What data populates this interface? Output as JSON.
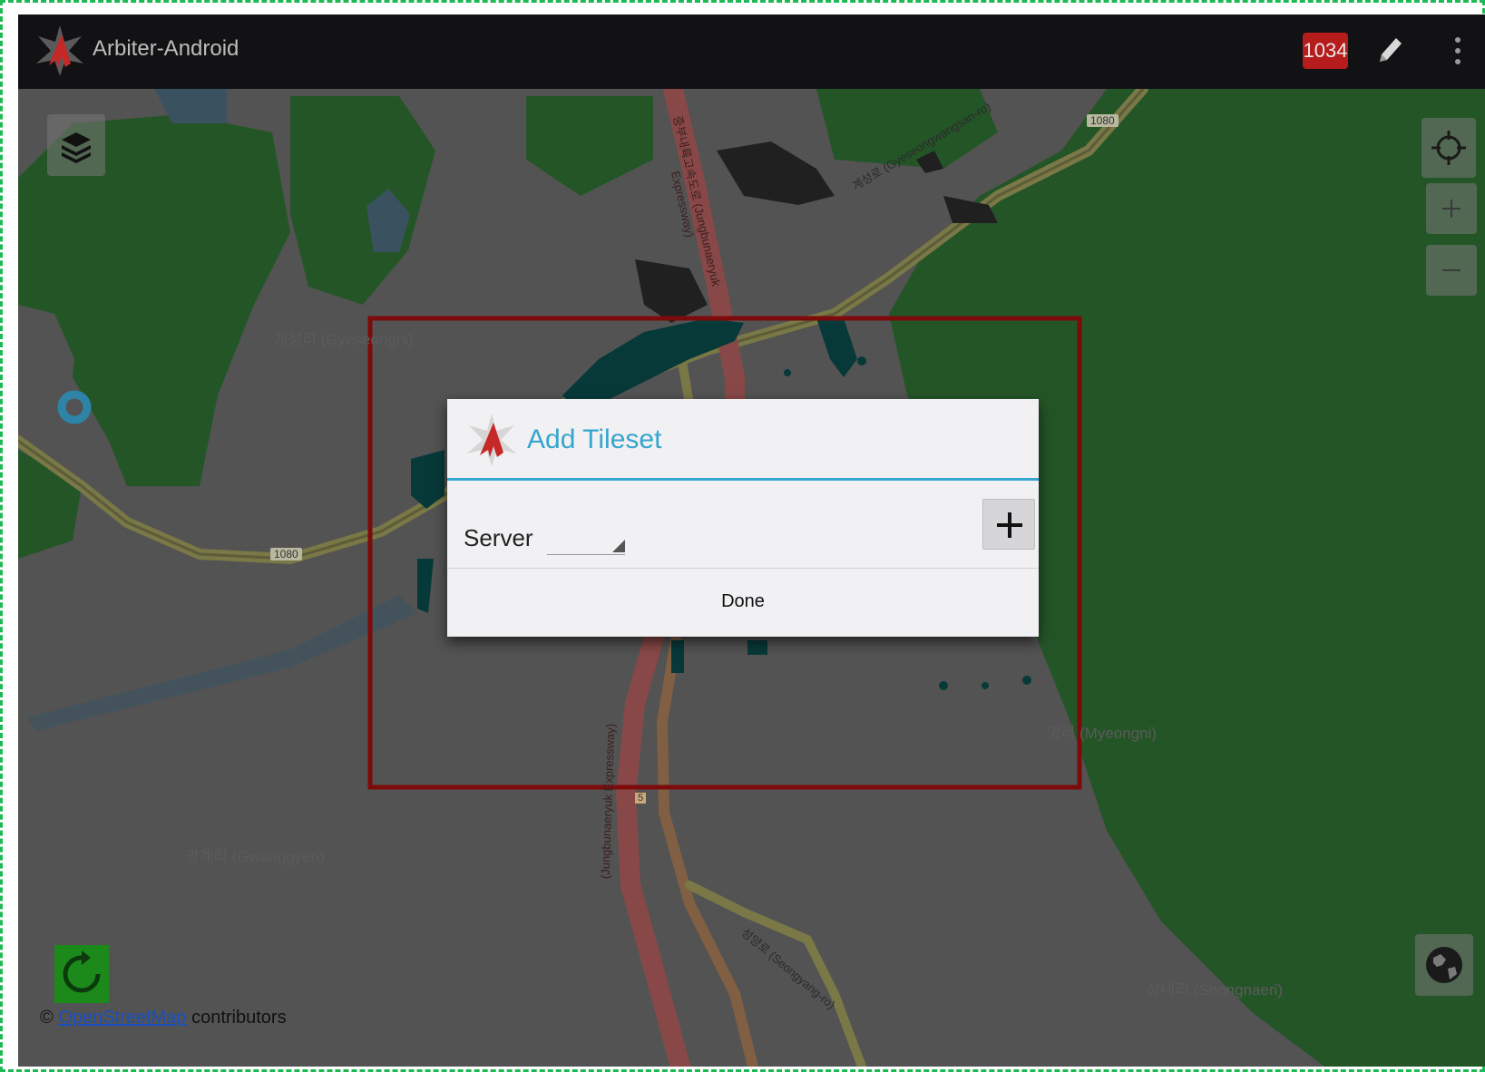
{
  "app": {
    "title": "Arbiter-Android",
    "notification_count": "1034"
  },
  "map": {
    "labels": {
      "village_1": "계성리 (Gyeseongni)",
      "village_2": "광계리 (Gwanggyeri)",
      "village_3": "명리 (Myeongni)",
      "village_4": "상내리 (Seongnaeri)",
      "route_1": "1080",
      "route_2": "1080",
      "expressway_north": "중부내륙고속도로 (Jungbunaeryuk Expressway)",
      "expressway_south": "(Jungbunaeryuk Expressway)",
      "road_east": "계성로 (Gyeseongwangsan-ro)",
      "road_south": "성양로 (Seongyang-ro)",
      "route_5": "5"
    },
    "attribution": {
      "prefix": "©",
      "link": "OpenStreetMap",
      "suffix": "contributors"
    },
    "colors": {
      "forest": "#2f6e32",
      "land": "#6b6b6b",
      "road": "#9b9a5a",
      "expressway": "#b05d5d",
      "buildings": "#0b4a4a",
      "selection": "#a10f0f",
      "location_marker": "#3aa9d6"
    }
  },
  "controls": {
    "layers": "layers-icon",
    "crosshair": "crosshair-icon",
    "zoom_in": "plus-icon",
    "zoom_out": "minus-icon",
    "globe": "globe-icon",
    "refresh": "refresh-icon",
    "edit": "pencil-icon",
    "overflow": "more-vert-icon"
  },
  "dialog": {
    "title": "Add Tileset",
    "server_label": "Server",
    "server_value": "",
    "add_button": "+",
    "done_label": "Done",
    "accent_color": "#35a6cf"
  }
}
